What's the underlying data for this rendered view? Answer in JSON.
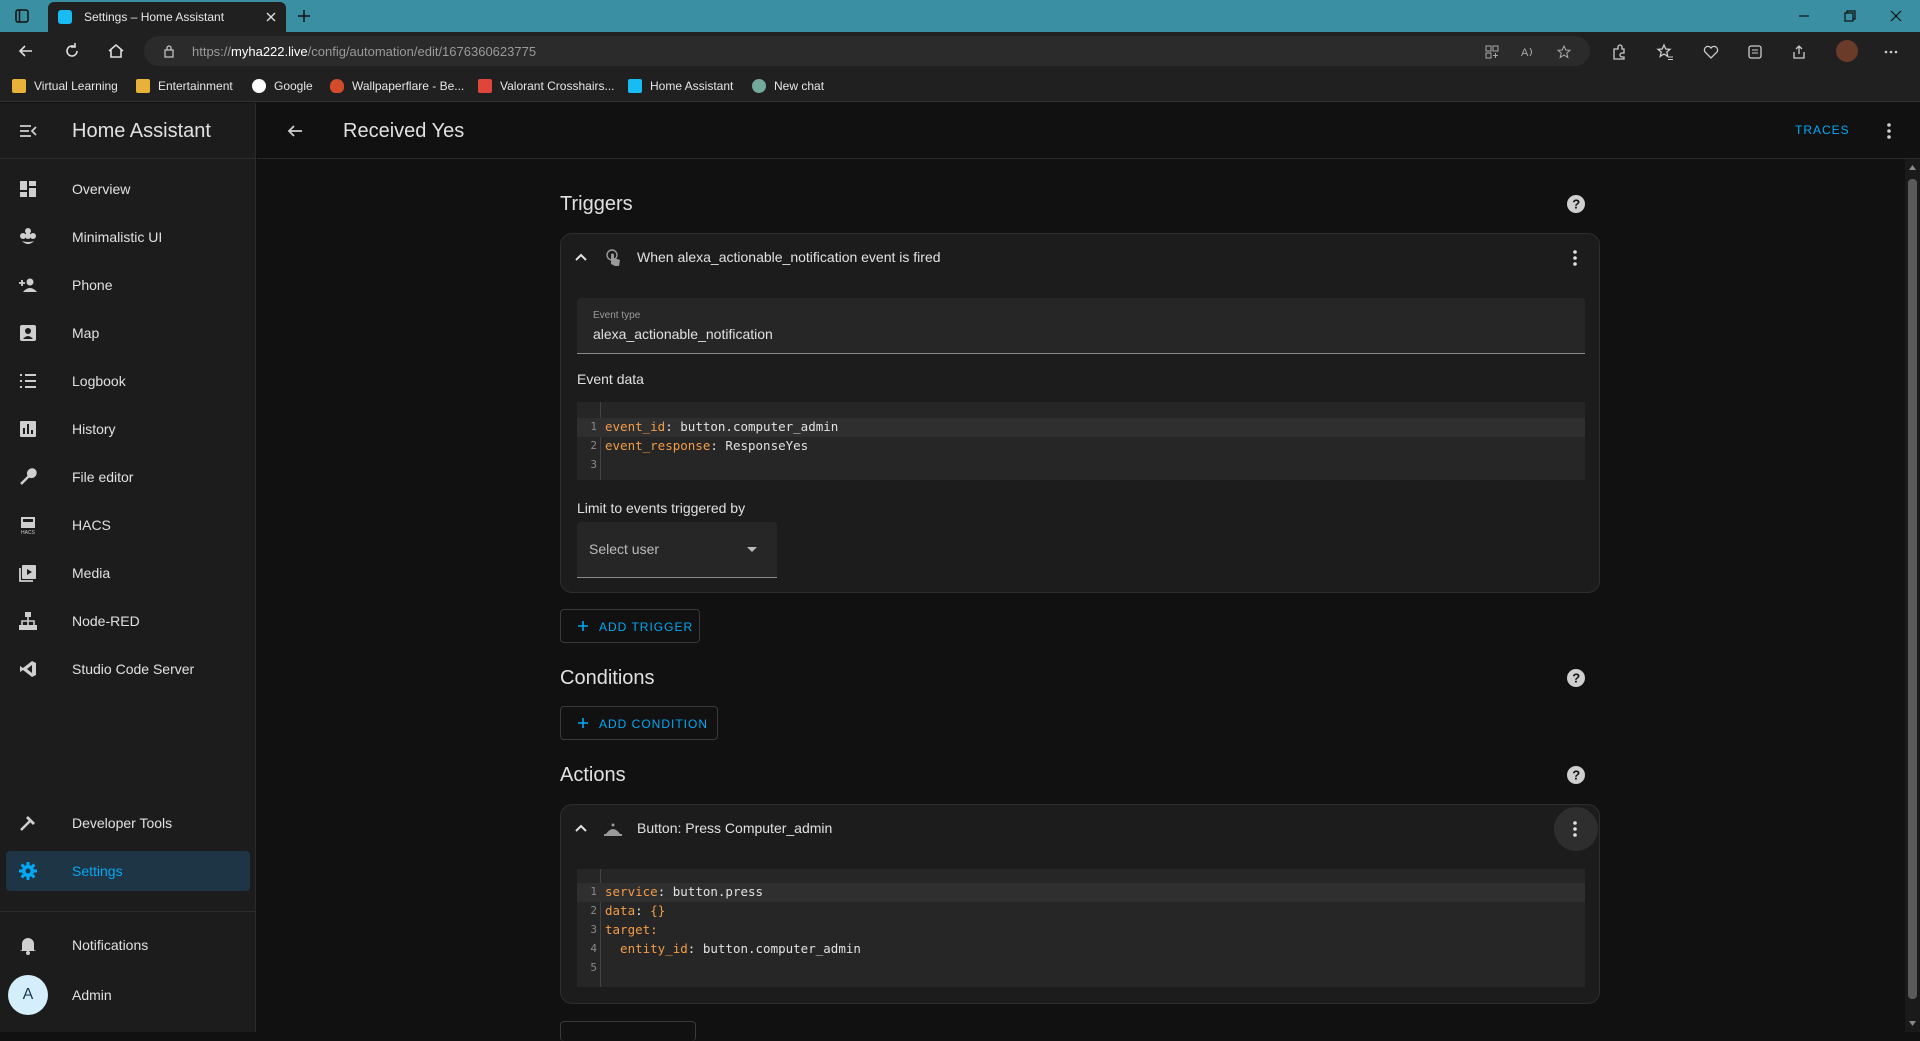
{
  "browser": {
    "tab_title": "Settings – Home Assistant",
    "url_prefix": "https://",
    "url_host": "myha222.live",
    "url_path": "/config/automation/edit/1676360623775",
    "bookmarks": [
      {
        "label": "Virtual Learning",
        "icon": "folder-icon",
        "color": "#e8b13a"
      },
      {
        "label": "Entertainment",
        "icon": "folder-icon",
        "color": "#e8b13a"
      },
      {
        "label": "Google",
        "icon": "google-icon",
        "color": "#ffffff"
      },
      {
        "label": "Wallpaperflare - Be...",
        "icon": "flame-icon",
        "color": "#d44b2b"
      },
      {
        "label": "Valorant Crosshairs...",
        "icon": "x-icon",
        "color": "#e0453a"
      },
      {
        "label": "Home Assistant",
        "icon": "home-assistant-icon",
        "color": "#18bcf2"
      },
      {
        "label": "New chat",
        "icon": "chatgpt-icon",
        "color": "#74aa9c"
      }
    ]
  },
  "sidebar": {
    "title": "Home Assistant",
    "items": [
      {
        "label": "Overview",
        "icon": "dashboard-icon"
      },
      {
        "label": "Minimalistic UI",
        "icon": "flower-icon"
      },
      {
        "label": "Phone",
        "icon": "account-plus-icon"
      },
      {
        "label": "Map",
        "icon": "map-icon"
      },
      {
        "label": "Logbook",
        "icon": "list-icon"
      },
      {
        "label": "History",
        "icon": "chart-icon"
      },
      {
        "label": "File editor",
        "icon": "wrench-icon"
      },
      {
        "label": "HACS",
        "icon": "hacs-icon"
      },
      {
        "label": "Media",
        "icon": "play-box-icon"
      },
      {
        "label": "Node-RED",
        "icon": "sitemap-icon"
      },
      {
        "label": "Studio Code Server",
        "icon": "vscode-icon"
      }
    ],
    "developer_tools": "Developer Tools",
    "settings": "Settings",
    "notifications": "Notifications",
    "user": "Admin",
    "user_initial": "A"
  },
  "topbar": {
    "title": "Received Yes",
    "traces": "TRACES"
  },
  "triggers": {
    "title": "Triggers",
    "card_title": "When alexa_actionable_notification event is fired",
    "event_type_label": "Event type",
    "event_type_value": "alexa_actionable_notification",
    "event_data_label": "Event data",
    "code": [
      {
        "n": "1",
        "key": "event_id",
        "val": " button.computer_admin"
      },
      {
        "n": "2",
        "key": "event_response",
        "val": " ResponseYes"
      },
      {
        "n": "3",
        "key": "",
        "val": ""
      }
    ],
    "limit_label": "Limit to events triggered by",
    "select_placeholder": "Select user",
    "add_button": "ADD TRIGGER"
  },
  "conditions": {
    "title": "Conditions",
    "add_button": "ADD CONDITION"
  },
  "actions": {
    "title": "Actions",
    "card_title": "Button: Press Computer_admin",
    "code": [
      {
        "n": "1",
        "key": "service",
        "val": " button.press"
      },
      {
        "n": "2",
        "key": "data",
        "val": " {}"
      },
      {
        "n": "3",
        "key": "target",
        "val": ""
      },
      {
        "n": "4",
        "key": "  entity_id",
        "val": " button.computer_admin"
      },
      {
        "n": "5",
        "key": "",
        "val": ""
      }
    ]
  },
  "colors": {
    "accent": "#03a9f4",
    "yaml_key": "#f29c4a",
    "tab_strip": "#3a8fa3"
  }
}
